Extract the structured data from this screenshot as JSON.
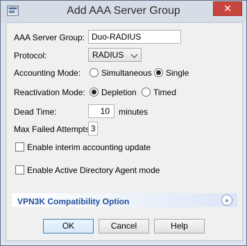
{
  "window": {
    "title": "Add AAA Server Group",
    "close_glyph": "✕",
    "icon": "app-window-icon"
  },
  "form": {
    "server_group": {
      "label": "AAA Server Group:",
      "value": "Duo-RADIUS"
    },
    "protocol": {
      "label": "Protocol:",
      "selected": "RADIUS"
    },
    "accounting_mode": {
      "label": "Accounting Mode:",
      "options": [
        "Simultaneous",
        "Single"
      ],
      "selected": "Single"
    },
    "reactivation_mode": {
      "label": "Reactivation Mode:",
      "options": [
        "Depletion",
        "Timed"
      ],
      "selected": "Depletion"
    },
    "dead_time": {
      "label": "Dead Time:",
      "value": "10",
      "unit": "minutes"
    },
    "max_failed_attempts": {
      "label": "Max Failed Attempts:",
      "value": "3"
    },
    "interim_accounting": {
      "label": "Enable interim accounting update",
      "checked": false
    },
    "ad_agent_mode": {
      "label": "Enable Active Directory Agent mode",
      "checked": false
    }
  },
  "section": {
    "title": "VPN3K Compatibility Option",
    "expander_glyph": "»"
  },
  "buttons": {
    "ok": "OK",
    "cancel": "Cancel",
    "help": "Help"
  }
}
